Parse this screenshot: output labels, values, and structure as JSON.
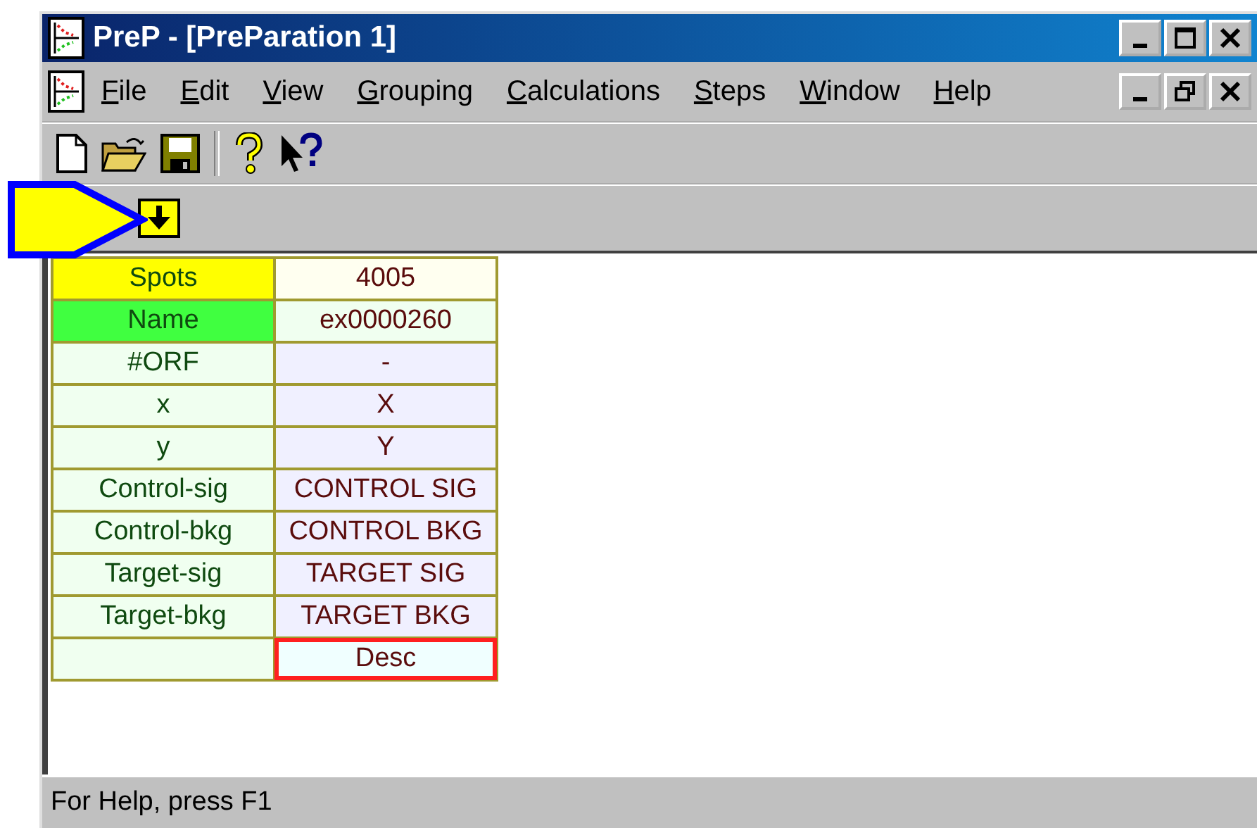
{
  "window": {
    "title": "PreP - [PreParation 1]"
  },
  "menu": [
    "File",
    "Edit",
    "View",
    "Grouping",
    "Calculations",
    "Steps",
    "Window",
    "Help"
  ],
  "grid": {
    "rows": [
      {
        "label": {
          "text": "Spots",
          "color": "#ffff00"
        },
        "value": {
          "text": "4005",
          "color": "#fffff0",
          "selected": false
        }
      },
      {
        "label": {
          "text": "Name",
          "color": "#40ff40"
        },
        "value": {
          "text": "ex0000260",
          "color": "#f0fff0",
          "selected": false
        }
      },
      {
        "label": {
          "text": "#ORF",
          "color": "#f0fff0"
        },
        "value": {
          "text": "-",
          "color": "#f0f0ff",
          "selected": false
        }
      },
      {
        "label": {
          "text": "x",
          "color": "#f0fff0"
        },
        "value": {
          "text": "X",
          "color": "#f0f0ff",
          "selected": false
        }
      },
      {
        "label": {
          "text": "y",
          "color": "#f0fff0"
        },
        "value": {
          "text": "Y",
          "color": "#f0f0ff",
          "selected": false
        }
      },
      {
        "label": {
          "text": "Control-sig",
          "color": "#f0fff0"
        },
        "value": {
          "text": "CONTROL SIG",
          "color": "#f0f0ff",
          "selected": false
        }
      },
      {
        "label": {
          "text": "Control-bkg",
          "color": "#f0fff0"
        },
        "value": {
          "text": "CONTROL BKG",
          "color": "#f0f0ff",
          "selected": false
        }
      },
      {
        "label": {
          "text": "Target-sig",
          "color": "#f0fff0"
        },
        "value": {
          "text": "TARGET SIG",
          "color": "#f0f0ff",
          "selected": false
        }
      },
      {
        "label": {
          "text": "Target-bkg",
          "color": "#f0fff0"
        },
        "value": {
          "text": "TARGET BKG",
          "color": "#f0f0ff",
          "selected": false
        }
      },
      {
        "label": {
          "color": "#f0fff0"
        },
        "value": {
          "text": "Desc",
          "color": "#f0ffff",
          "selected": true
        }
      }
    ]
  },
  "status_bar": "For Help, press F1"
}
